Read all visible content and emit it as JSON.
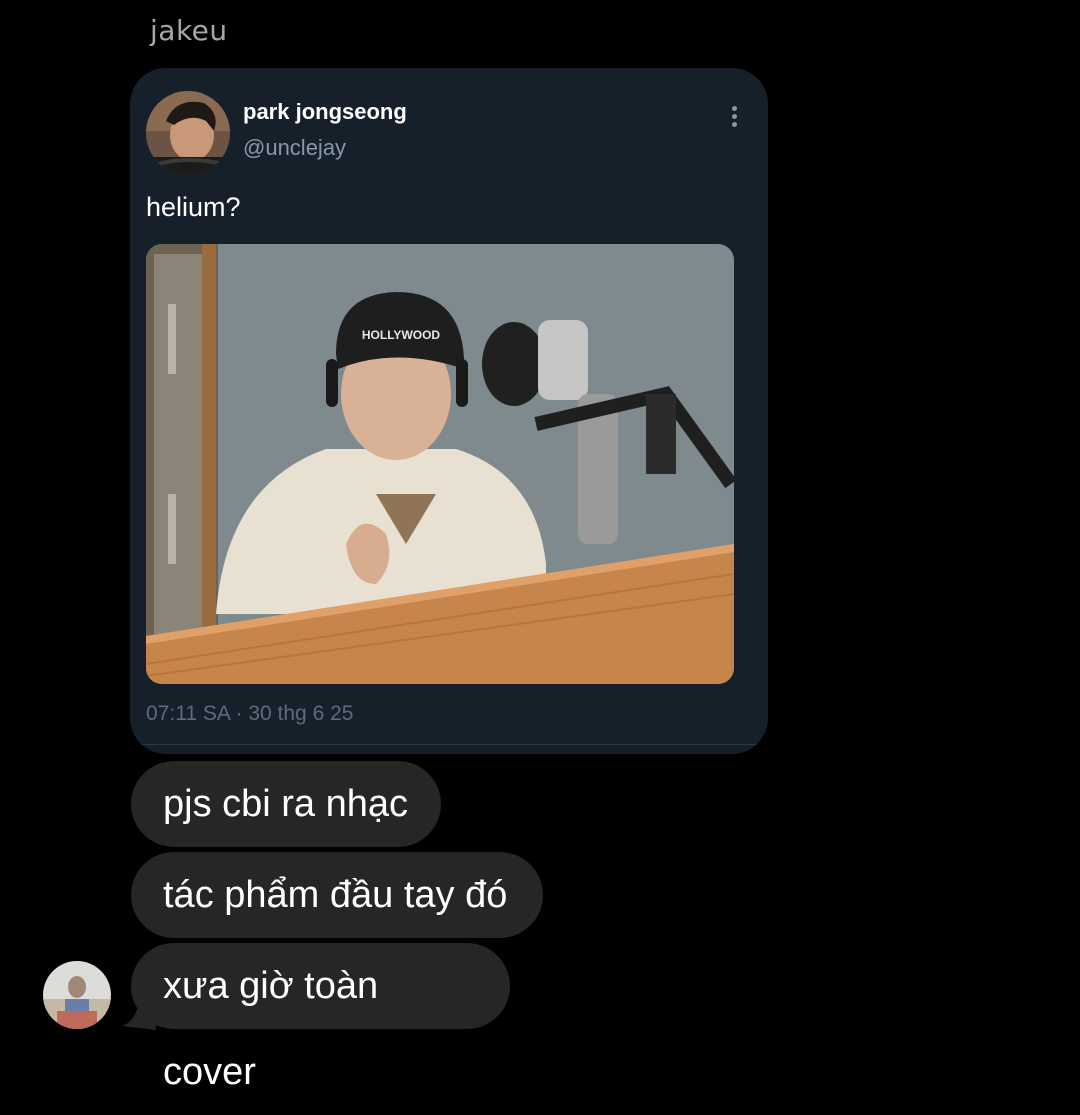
{
  "sender_name": "jakeu",
  "tweet": {
    "author_name": "park jongseong",
    "author_handle": "@unclejay",
    "avatar_icon": "profile-photo",
    "more_icon": "more-vertical-icon",
    "text": "helium?",
    "photo_cap_text": "HOLLYWOOD",
    "timestamp": "07:11 SA · 30 thg 6 25",
    "colors": {
      "card_bg": "#15202b",
      "handle": "#8899a6",
      "timestamp": "#5b6c7b"
    }
  },
  "messages": [
    {
      "text": "pjs cbi ra nhạc"
    },
    {
      "text": "tác phẩm đầu tay đó"
    },
    {
      "text": "xưa giờ toàn cover"
    }
  ],
  "colors": {
    "background": "#000000",
    "bubble": "#262626",
    "sender_label": "#a6a6a6"
  }
}
